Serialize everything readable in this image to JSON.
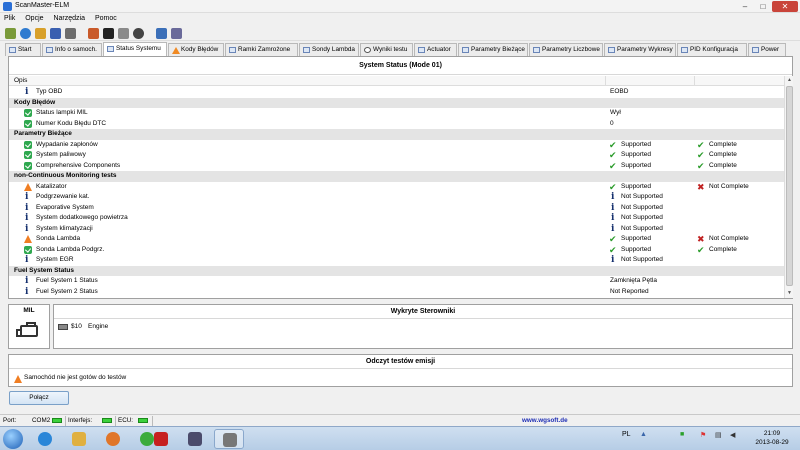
{
  "window": {
    "title": "ScanMaster-ELM",
    "min": "–",
    "max": "□",
    "close": "✕"
  },
  "menu": [
    "Plik",
    "Opcje",
    "Narzędzia",
    "Pomoc"
  ],
  "tabs": [
    {
      "label": "Start"
    },
    {
      "label": "Info o samoch."
    },
    {
      "label": "Status Systemu"
    },
    {
      "label": "Kody Błędów"
    },
    {
      "label": "Ramki Zamrożone"
    },
    {
      "label": "Sondy Lambda"
    },
    {
      "label": "Wyniki testu"
    },
    {
      "label": "Actuator"
    },
    {
      "label": "Parametry Bieżące"
    },
    {
      "label": "Parametry Liczbowe"
    },
    {
      "label": "Parametry Wykresy"
    },
    {
      "label": "PID Konfiguracja"
    },
    {
      "label": "Power"
    }
  ],
  "active_tab": "Status Systemu",
  "main": {
    "title": "System Status (Mode 01)",
    "col_header": "Opis",
    "rows": [
      {
        "kind": "item",
        "icon": "info",
        "label": "Typ OBD",
        "v1": "EOBD"
      },
      {
        "kind": "group",
        "label": "Kody Błędów"
      },
      {
        "kind": "item",
        "icon": "ok",
        "label": "Status lampki MIL",
        "v1": "Wył"
      },
      {
        "kind": "item",
        "icon": "ok",
        "label": "Numer Kodu Błędu DTC",
        "v1": "0"
      },
      {
        "kind": "group",
        "label": "Parametry Bieżące"
      },
      {
        "kind": "item",
        "icon": "ok",
        "label": "Wypadanie zapłonów",
        "s1": "Supported",
        "s1i": "check",
        "s2": "Complete",
        "s2i": "check"
      },
      {
        "kind": "item",
        "icon": "ok",
        "label": "System paliwowy",
        "s1": "Supported",
        "s1i": "check",
        "s2": "Complete",
        "s2i": "check"
      },
      {
        "kind": "item",
        "icon": "ok",
        "label": "Comprehensive Components",
        "s1": "Supported",
        "s1i": "check",
        "s2": "Complete",
        "s2i": "check"
      },
      {
        "kind": "group",
        "label": "non-Continuous Monitoring tests"
      },
      {
        "kind": "item",
        "icon": "warn",
        "label": "Katalizator",
        "s1": "Supported",
        "s1i": "check",
        "s2": "Not Complete",
        "s2i": "cross"
      },
      {
        "kind": "item",
        "icon": "info",
        "label": "Podgrzewanie kat.",
        "s1": "Not Supported",
        "s1i": "info"
      },
      {
        "kind": "item",
        "icon": "info",
        "label": "Evaporative System",
        "s1": "Not Supported",
        "s1i": "info"
      },
      {
        "kind": "item",
        "icon": "info",
        "label": "System dodatkowego powietrza",
        "s1": "Not Supported",
        "s1i": "info"
      },
      {
        "kind": "item",
        "icon": "info",
        "label": "System klimatyzacji",
        "s1": "Not Supported",
        "s1i": "info"
      },
      {
        "kind": "item",
        "icon": "warn",
        "label": "Sonda Lambda",
        "s1": "Supported",
        "s1i": "check",
        "s2": "Not Complete",
        "s2i": "cross"
      },
      {
        "kind": "item",
        "icon": "ok",
        "label": "Sonda Lambda Podgrz.",
        "s1": "Supported",
        "s1i": "check",
        "s2": "Complete",
        "s2i": "check"
      },
      {
        "kind": "item",
        "icon": "info",
        "label": "System EGR",
        "s1": "Not Supported",
        "s1i": "info"
      },
      {
        "kind": "group",
        "label": "Fuel System Status"
      },
      {
        "kind": "item",
        "icon": "info",
        "label": "Fuel System 1 Status",
        "v1": "Zamknięta Pętla"
      },
      {
        "kind": "item",
        "icon": "info",
        "label": "Fuel System 2 Status",
        "v1": "Not Reported"
      }
    ]
  },
  "mil": {
    "label": "MIL"
  },
  "controllers": {
    "title": "Wykryte Sterowniki",
    "items": [
      {
        "id": "$10",
        "name": "Engine"
      }
    ]
  },
  "emission": {
    "title": "Odczyt testów emisji",
    "message": "Samochód nie jest gotów do testów"
  },
  "connect_button": "Połącz",
  "statusbar": {
    "port_label": "Port:",
    "port_value": "COM2",
    "interface_label": "Interfejs:",
    "ecu_label": "ECU:",
    "website": "www.wgsoft.de"
  },
  "taskbar": {
    "lang": "PL",
    "time": "21:09",
    "date": "2013-08-29"
  },
  "colors": {
    "ok": "#2fa84f",
    "warn": "#f07e22",
    "error": "#c02222",
    "led": "#3cd13c",
    "link": "#1f2fb5"
  }
}
